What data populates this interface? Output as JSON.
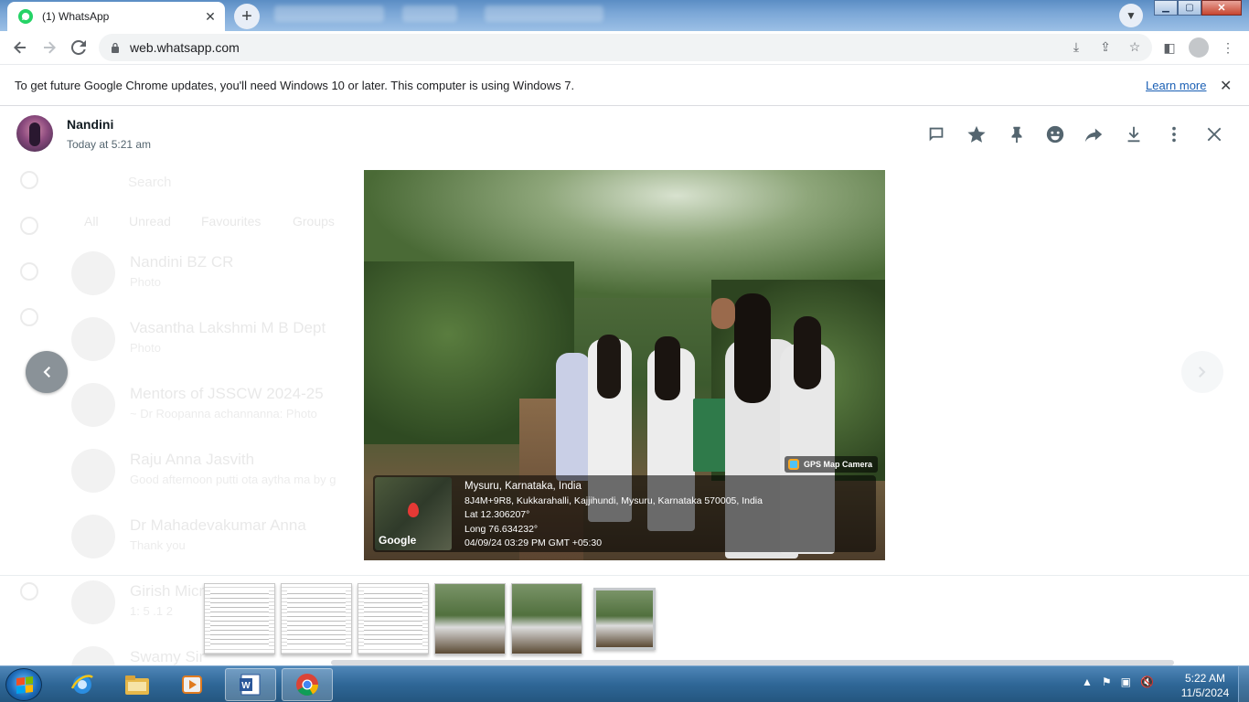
{
  "browser": {
    "tab_title": "(1) WhatsApp",
    "url": "web.whatsapp.com"
  },
  "infobar": {
    "message": "To get future Google Chrome updates, you'll need Windows 10 or later. This computer is using Windows 7.",
    "learn_more": "Learn more"
  },
  "viewer": {
    "sender_name": "Nandini",
    "sender_time": "Today at 5:21 am",
    "actions": [
      "reply-icon",
      "star-icon",
      "pin-icon",
      "emoji-icon",
      "forward-icon",
      "download-icon",
      "menu-icon",
      "close-icon"
    ],
    "photo": {
      "gps_camera_label": "GPS Map Camera",
      "map_logo": "Google",
      "location_title": "Mysuru, Karnataka, India",
      "address": "8J4M+9R8, Kukkarahalli, Kajjihundi, Mysuru, Karnataka 570005, India",
      "lat": "Lat 12.306207°",
      "long": "Long 76.634232°",
      "datetime": "04/09/24 03:29 PM GMT +05:30"
    }
  },
  "background_chats": {
    "search": "Search",
    "filters": [
      "All",
      "Unread",
      "Favourites",
      "Groups"
    ],
    "chats": [
      {
        "name": "Nandini BZ CR",
        "sub": "Photo"
      },
      {
        "name": "Vasantha Lakshmi M B Dept",
        "sub": "Photo"
      },
      {
        "name": "Mentors of JSSCW 2024-25",
        "sub": "~ Dr Roopanna achannanna: Photo"
      },
      {
        "name": "Raju Anna Jasvith",
        "sub": "Good afternoon putti ota aytha ma by g"
      },
      {
        "name": "Dr Mahadevakumar Anna",
        "sub": "Thank you"
      },
      {
        "name": "Girish Micr",
        "sub": "1: 5 .1 2"
      },
      {
        "name": "Swamy Sir",
        "sub": ""
      }
    ]
  },
  "taskbar": {
    "time": "5:22 AM",
    "date": "11/5/2024"
  }
}
